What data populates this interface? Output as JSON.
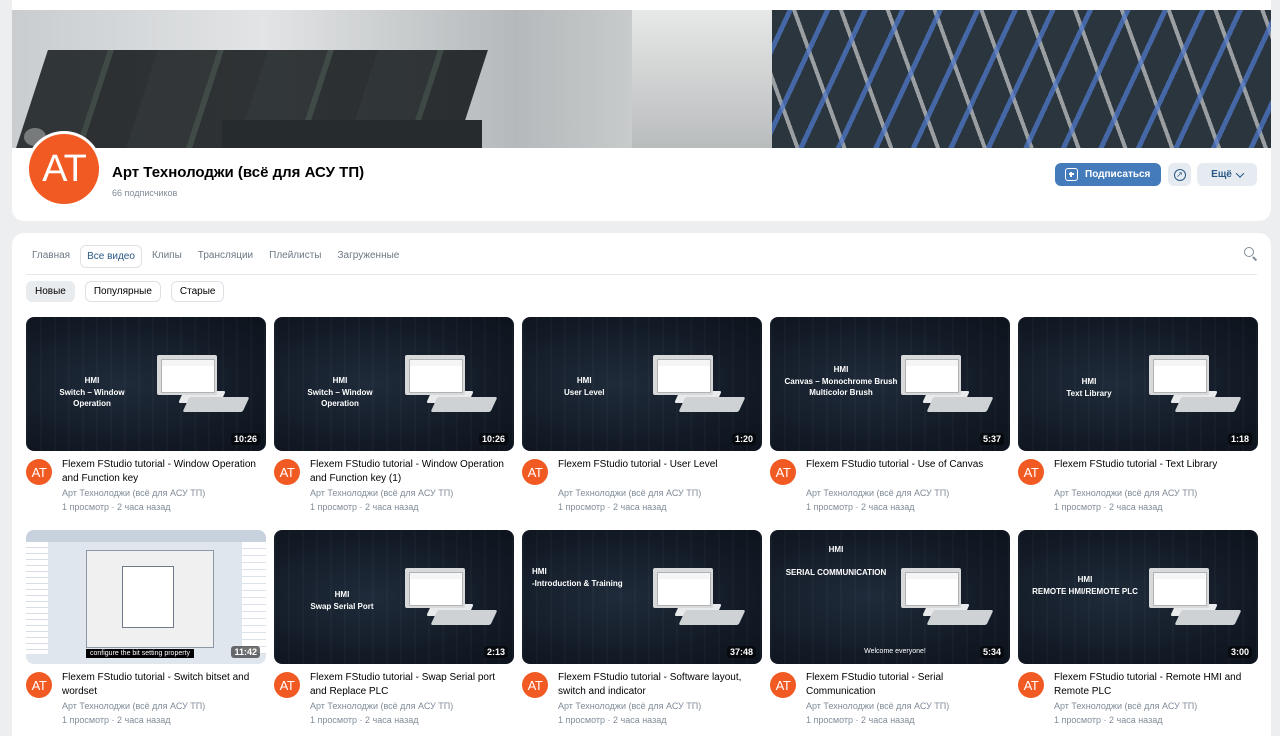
{
  "channel": {
    "avatar_text": "AT",
    "name": "Арт Технолоджи (всё для АСУ ТП)",
    "subscribers": "66 подписчиков",
    "subscribe_label": "Подписаться",
    "more_label": "Ещё"
  },
  "colors": {
    "accent": "#447bba",
    "avatar": "#f15a22",
    "link": "#2a5885",
    "muted": "#818c99"
  },
  "tabs": [
    {
      "label": "Главная"
    },
    {
      "label": "Все видео"
    },
    {
      "label": "Клипы"
    },
    {
      "label": "Трансляции"
    },
    {
      "label": "Плейлисты"
    },
    {
      "label": "Загруженные"
    }
  ],
  "active_tab": "Все видео",
  "filters": [
    {
      "label": "Новые"
    },
    {
      "label": "Популярные"
    },
    {
      "label": "Старые"
    }
  ],
  "active_filter": "Новые",
  "videos": [
    {
      "thumb_text": "HMI\nSwitch – Window Operation",
      "duration": "10:26",
      "title": "Flexem FStudio tutorial - Window Operation and Function key",
      "channel": "Арт Технолоджи (всё для АСУ ТП)",
      "stats": "1 просмотр · 2 часа назад"
    },
    {
      "thumb_text": "HMI\nSwitch – Window Operation",
      "duration": "10:26",
      "title": "Flexem FStudio tutorial - Window Operation and Function key (1)",
      "channel": "Арт Технолоджи (всё для АСУ ТП)",
      "stats": "1 просмотр · 2 часа назад"
    },
    {
      "thumb_text": "HMI\nUser Level",
      "duration": "1:20",
      "title": "Flexem FStudio tutorial - User Level",
      "channel": "Арт Технолоджи (всё для АСУ ТП)",
      "stats": "1 просмотр · 2 часа назад"
    },
    {
      "thumb_text": "HMI\nCanvas – Monochrome Brush\nMulticolor Brush",
      "duration": "5:37",
      "title": "Flexem FStudio tutorial - Use of Canvas",
      "channel": "Арт Технолоджи (всё для АСУ ТП)",
      "stats": "1 просмотр · 2 часа назад"
    },
    {
      "thumb_text": "HMI\nText Library",
      "duration": "1:18",
      "title": "Flexem FStudio tutorial - Text Library",
      "channel": "Арт Технолоджи (всё для АСУ ТП)",
      "stats": "1 просмотр · 2 часа назад"
    },
    {
      "thumb_text": "configure the bit setting property",
      "duration": "11:42",
      "title": "Flexem FStudio tutorial - Switch bitset and wordset",
      "channel": "Арт Технолоджи (всё для АСУ ТП)",
      "stats": "1 просмотр · 2 часа назад"
    },
    {
      "thumb_text": "HMI\nSwap Serial Port",
      "duration": "2:13",
      "title": "Flexem FStudio tutorial - Swap Serial port and Replace PLC",
      "channel": "Арт Технолоджи (всё для АСУ ТП)",
      "stats": "1 просмотр · 2 часа назад"
    },
    {
      "thumb_text": "HMI\n-Introduction & Training",
      "duration": "37:48",
      "title": "Flexem FStudio tutorial - Software layout, switch and indicator",
      "channel": "Арт Технолоджи (всё для АСУ ТП)",
      "stats": "1 просмотр · 2 часа назад"
    },
    {
      "thumb_text": "HMI\n\nSERIAL COMMUNICATION",
      "thumb_caption": "Welcome everyone!",
      "duration": "5:34",
      "title": "Flexem FStudio tutorial - Serial Communication",
      "channel": "Арт Технолоджи (всё для АСУ ТП)",
      "stats": "1 просмотр · 2 часа назад"
    },
    {
      "thumb_text": "HMI\nREMOTE HMI/REMOTE PLC",
      "duration": "3:00",
      "title": "Flexem FStudio tutorial - Remote HMI and Remote PLC",
      "channel": "Арт Технолоджи (всё для АСУ ТП)",
      "stats": "1 просмотр · 2 часа назад"
    }
  ]
}
